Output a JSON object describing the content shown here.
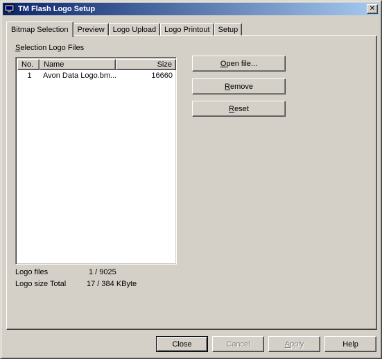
{
  "window": {
    "title": "TM Flash Logo Setup",
    "close_glyph": "✕"
  },
  "tabs": [
    {
      "label": "Bitmap Selection",
      "active": true
    },
    {
      "label": "Preview",
      "active": false
    },
    {
      "label": "Logo Upload",
      "active": false
    },
    {
      "label": "Logo Printout",
      "active": false
    },
    {
      "label": "Setup",
      "active": false
    }
  ],
  "selection": {
    "group_label_prefix": "",
    "group_label_mnemonic": "S",
    "group_label_rest": "election Logo Files",
    "columns": [
      "No.",
      "Name",
      "Size"
    ],
    "rows": [
      {
        "no": "1",
        "name": "Avon Data Logo.bm...",
        "size": "16660"
      }
    ]
  },
  "actions": {
    "open": {
      "mnemonic": "O",
      "rest": "pen file..."
    },
    "remove": {
      "mnemonic": "R",
      "rest": "emove"
    },
    "reset": {
      "mnemonic": "R",
      "rest": "eset"
    }
  },
  "stats": {
    "logo_files_label": "Logo files",
    "logo_files_value": "1 / 9025",
    "logo_size_label": "Logo size Total",
    "logo_size_value": "17 / 384 KByte"
  },
  "footer": {
    "close": "Close",
    "cancel": "Cancel",
    "apply_mnemonic": "A",
    "apply_rest": "pply",
    "help": "Help"
  },
  "icons": {
    "app": "monitor-icon",
    "close": "close-icon"
  }
}
